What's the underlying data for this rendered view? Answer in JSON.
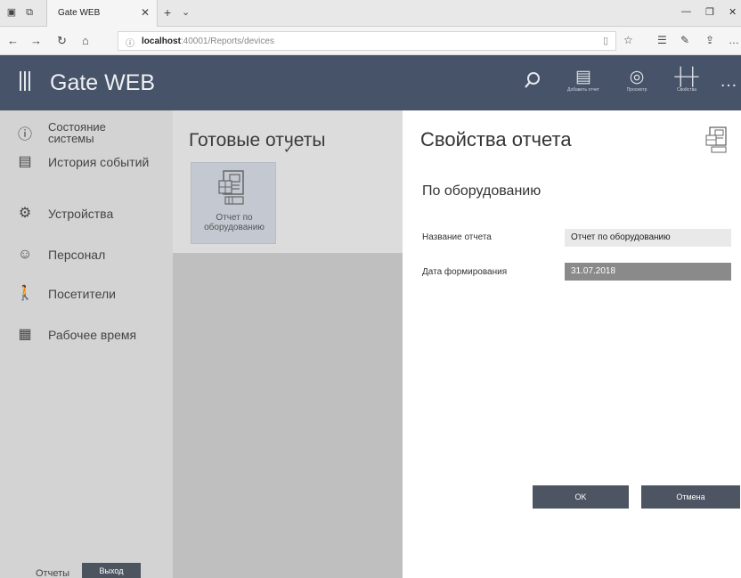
{
  "browser": {
    "tab_title": "Gate WEB",
    "url_host": "localhost",
    "url_path": ":40001/Reports/devices"
  },
  "app": {
    "title": "Gate WEB",
    "header_actions": [
      {
        "icon": "add-report-icon",
        "label": "Добавить отчет"
      },
      {
        "icon": "eye-icon",
        "label": "Просмотр"
      },
      {
        "icon": "sliders-icon",
        "label": "Свойства"
      }
    ]
  },
  "sidebar": {
    "items": [
      {
        "icon": "info-icon",
        "label": "Состояние системы"
      },
      {
        "icon": "event-history-icon",
        "label": "История событий"
      },
      {
        "icon": "gear-icon",
        "label": "Устройства"
      },
      {
        "icon": "personnel-icon",
        "label": "Персонал"
      },
      {
        "icon": "visitor-icon",
        "label": "Посетители"
      },
      {
        "icon": "worktime-icon",
        "label": "Рабочее время"
      }
    ],
    "footer_reports": "Отчеты",
    "footer_exit": "Выход"
  },
  "reports": {
    "title": "Готовые отчеты",
    "tiles": [
      {
        "label": "Отчет по оборудованию",
        "selected": true
      }
    ]
  },
  "properties": {
    "title": "Свойства отчета",
    "subtitle": "По оборудованию",
    "fields": [
      {
        "label": "Название отчета",
        "value": "Отчет по оборудованию"
      },
      {
        "label": "Дата формирования",
        "value": "31.07.2018"
      }
    ],
    "ok_label": "OK",
    "cancel_label": "Отмена"
  }
}
